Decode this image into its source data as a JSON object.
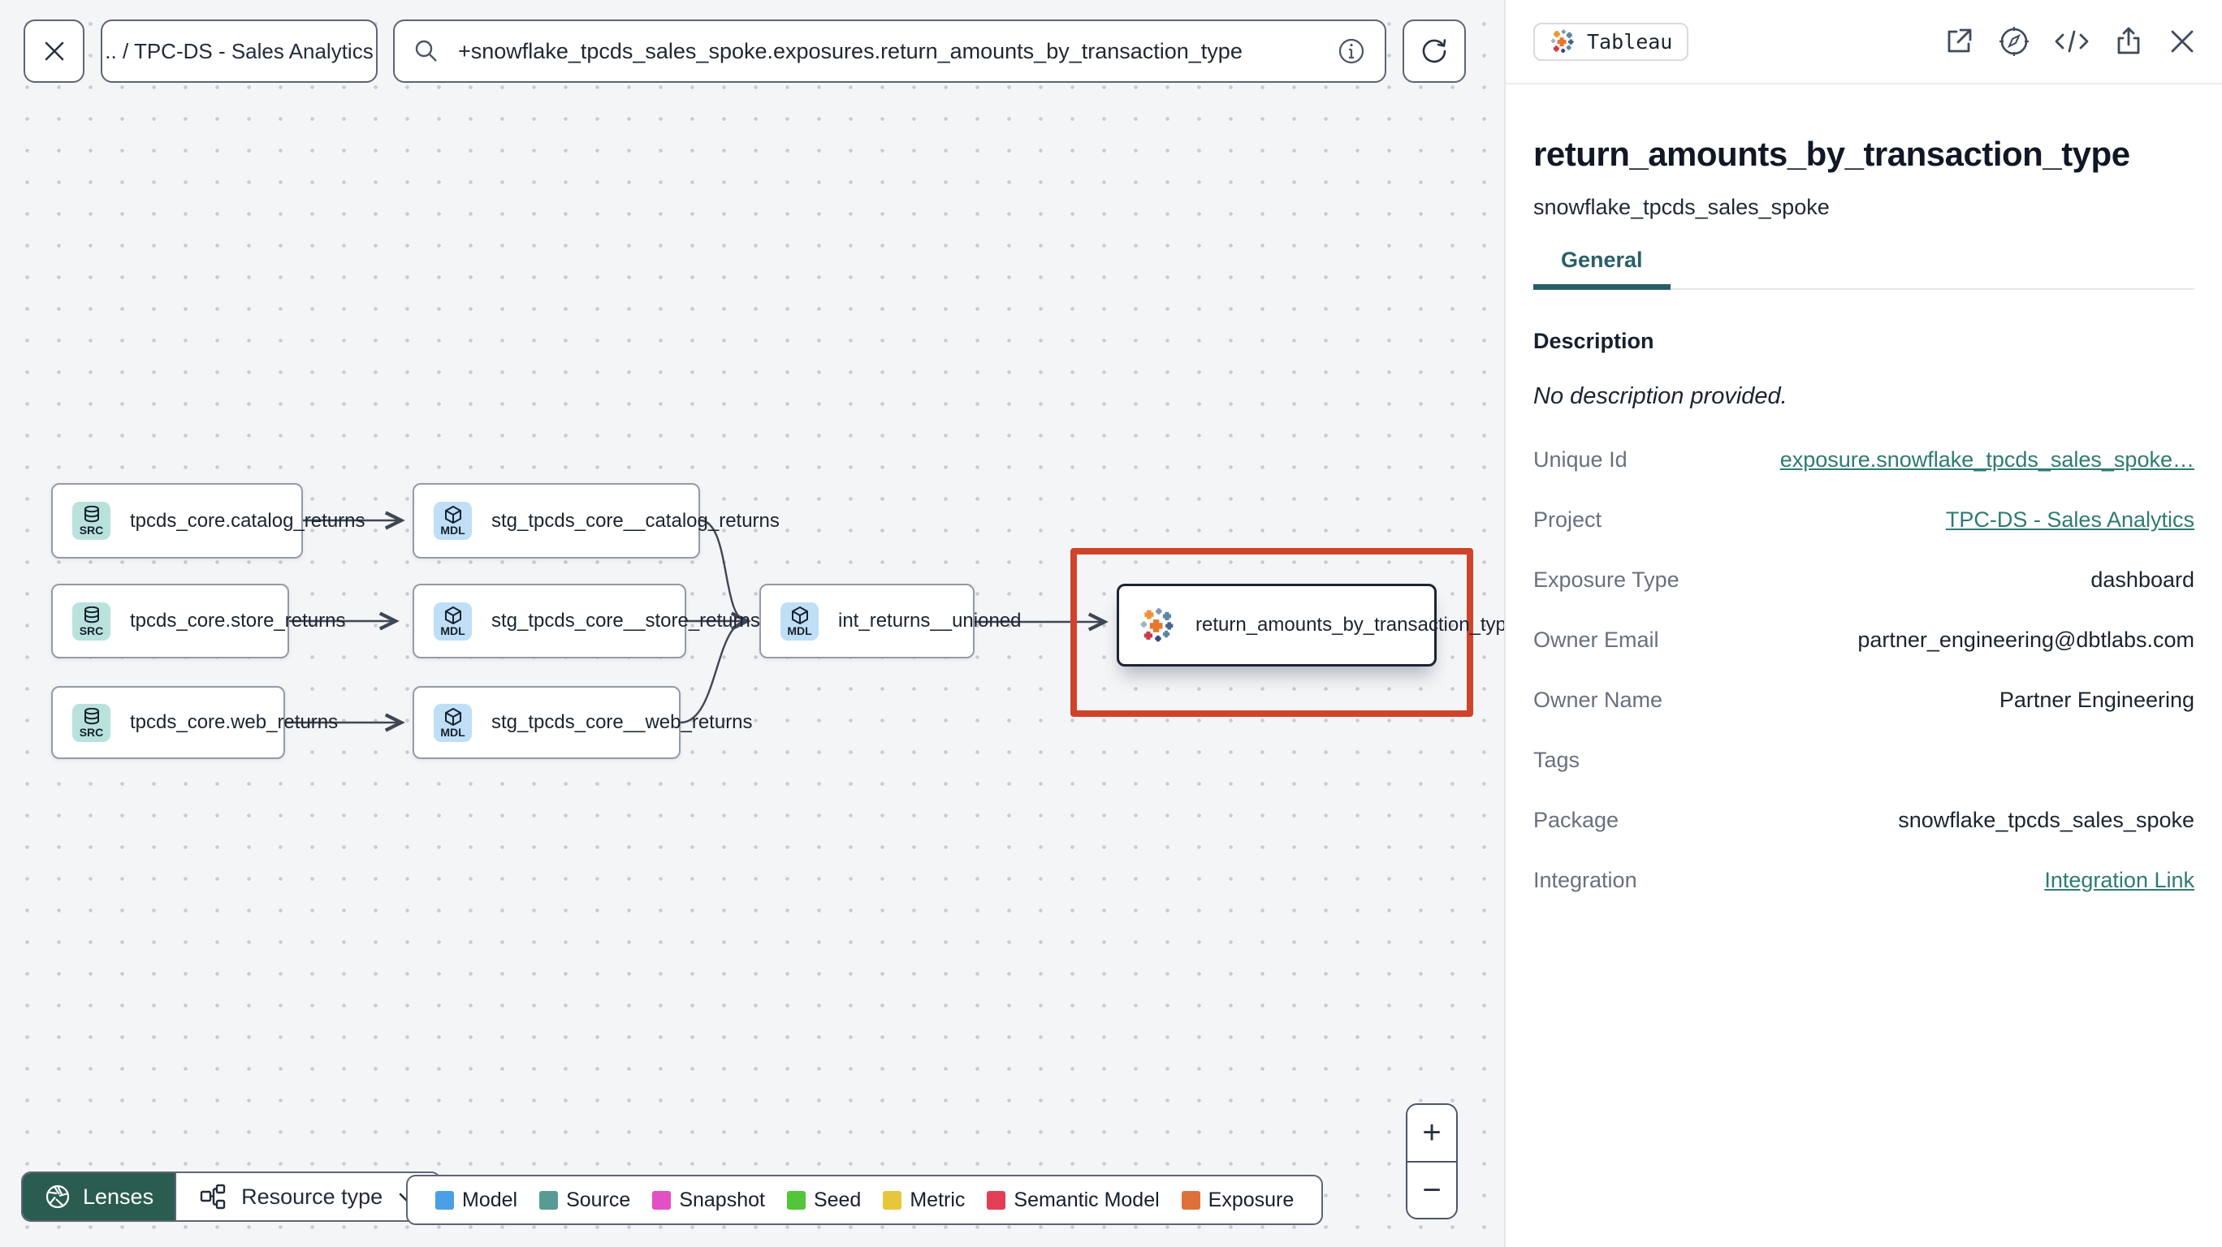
{
  "topbar": {
    "breadcrumb": ".. / TPC-DS - Sales Analytics",
    "search_value": "+snowflake_tpcds_sales_spoke.exposures.return_amounts_by_transaction_type"
  },
  "graph": {
    "nodes": [
      {
        "type": "source",
        "badge": "SRC",
        "label": "tpcds_core.catalog_returns"
      },
      {
        "type": "source",
        "badge": "SRC",
        "label": "tpcds_core.store_returns"
      },
      {
        "type": "source",
        "badge": "SRC",
        "label": "tpcds_core.web_returns"
      },
      {
        "type": "model",
        "badge": "MDL",
        "label": "stg_tpcds_core__catalog_returns"
      },
      {
        "type": "model",
        "badge": "MDL",
        "label": "stg_tpcds_core__store_returns"
      },
      {
        "type": "model",
        "badge": "MDL",
        "label": "stg_tpcds_core__web_returns"
      },
      {
        "type": "model",
        "badge": "MDL",
        "label": "int_returns__unioned"
      },
      {
        "type": "exposure",
        "badge": "",
        "label": "return_amounts_by_transaction_type"
      }
    ],
    "highlight_color": "#d0432b"
  },
  "controls": {
    "lenses_label": "Lenses",
    "resource_type_label": "Resource type",
    "zoom_in": "+",
    "zoom_out": "−"
  },
  "legend": {
    "items": [
      {
        "label": "Model",
        "color": "#4b9fe6"
      },
      {
        "label": "Source",
        "color": "#579b94"
      },
      {
        "label": "Snapshot",
        "color": "#e44fc4"
      },
      {
        "label": "Seed",
        "color": "#52c53a"
      },
      {
        "label": "Metric",
        "color": "#e6c73c"
      },
      {
        "label": "Semantic Model",
        "color": "#e23f55"
      },
      {
        "label": "Exposure",
        "color": "#e0703a"
      }
    ]
  },
  "panel": {
    "tool_badge": "Tableau",
    "title": "return_amounts_by_transaction_type",
    "subtitle": "snowflake_tpcds_sales_spoke",
    "tabs": [
      {
        "label": "General",
        "active": true
      }
    ],
    "description_heading": "Description",
    "description_empty": "No description provided.",
    "accent_teal": "#2e7b72",
    "details": [
      {
        "label": "Unique Id",
        "value": "exposure.snowflake_tpcds_sales_spoke…",
        "link": true
      },
      {
        "label": "Project",
        "value": "TPC-DS - Sales Analytics",
        "link": true
      },
      {
        "label": "Exposure Type",
        "value": "dashboard",
        "link": false
      },
      {
        "label": "Owner Email",
        "value": "partner_engineering@dbtlabs.com",
        "link": false
      },
      {
        "label": "Owner Name",
        "value": "Partner Engineering",
        "link": false
      },
      {
        "label": "Tags",
        "value": "",
        "link": false
      },
      {
        "label": "Package",
        "value": "snowflake_tpcds_sales_spoke",
        "link": false
      },
      {
        "label": "Integration",
        "value": "Integration Link",
        "link": true
      }
    ]
  }
}
